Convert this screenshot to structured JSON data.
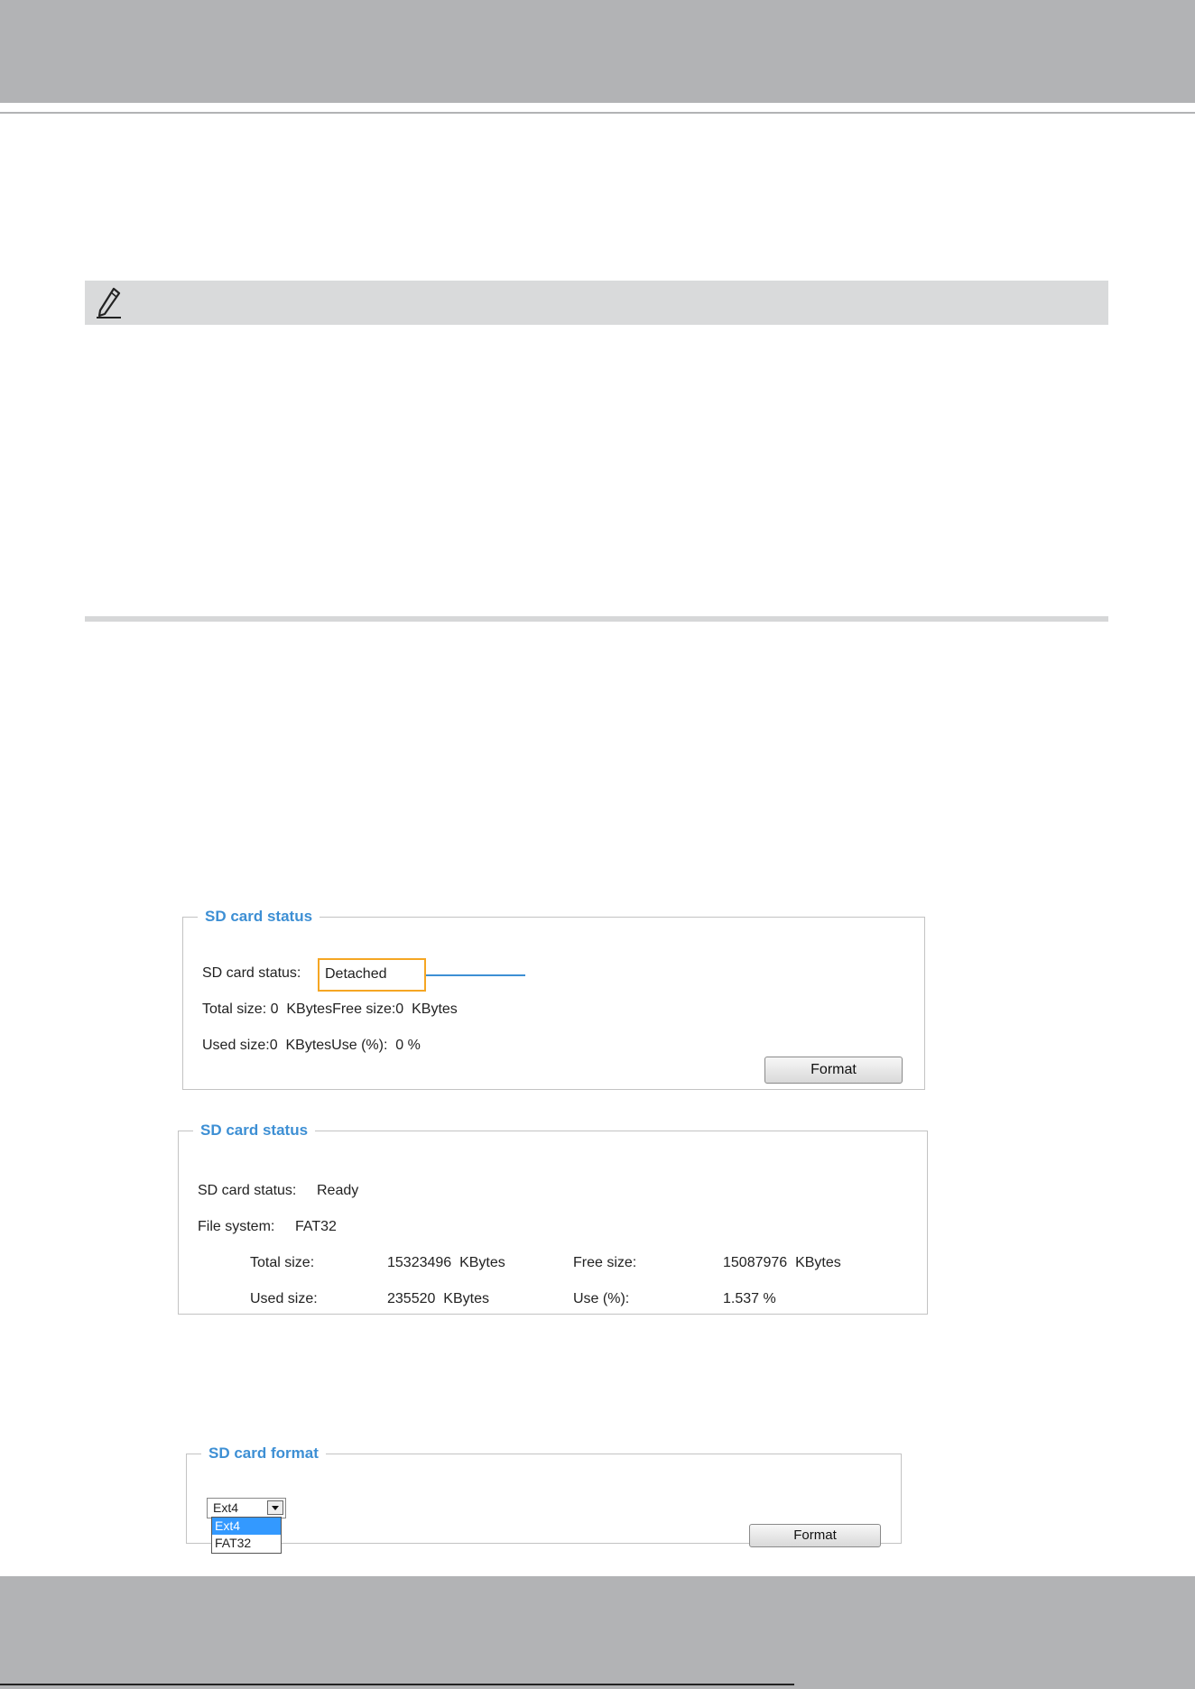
{
  "panel1": {
    "legend": "SD card status",
    "status_label": "SD card status:",
    "status_value": "Detached",
    "total_line": "Total size: 0  KBytesFree size:0  KBytes",
    "used_line": "Used size:0  KBytesUse (%):  0 %",
    "format_button": "Format"
  },
  "panel2": {
    "legend": "SD card status",
    "status_label": "SD card status:",
    "status_value": "Ready",
    "fs_label": "File system:",
    "fs_value": "FAT32",
    "total_label": "Total size:",
    "total_value": "15323496  KBytes",
    "free_label": "Free size:",
    "free_value": "15087976  KBytes",
    "used_label": "Used size:",
    "used_value": "235520  KBytes",
    "use_label": "Use (%):",
    "use_value": "1.537 %"
  },
  "panel3": {
    "legend": "SD card format",
    "select_value": "Ext4",
    "options": [
      "Ext4",
      "FAT32"
    ],
    "format_button": "Format"
  },
  "colors": {
    "header_bar": "#b2b3b5",
    "legend_text": "#3d8fd4",
    "highlight_box": "#f5a623",
    "selected_option": "#3399ff"
  },
  "icons": {
    "note": "pencil-icon"
  }
}
